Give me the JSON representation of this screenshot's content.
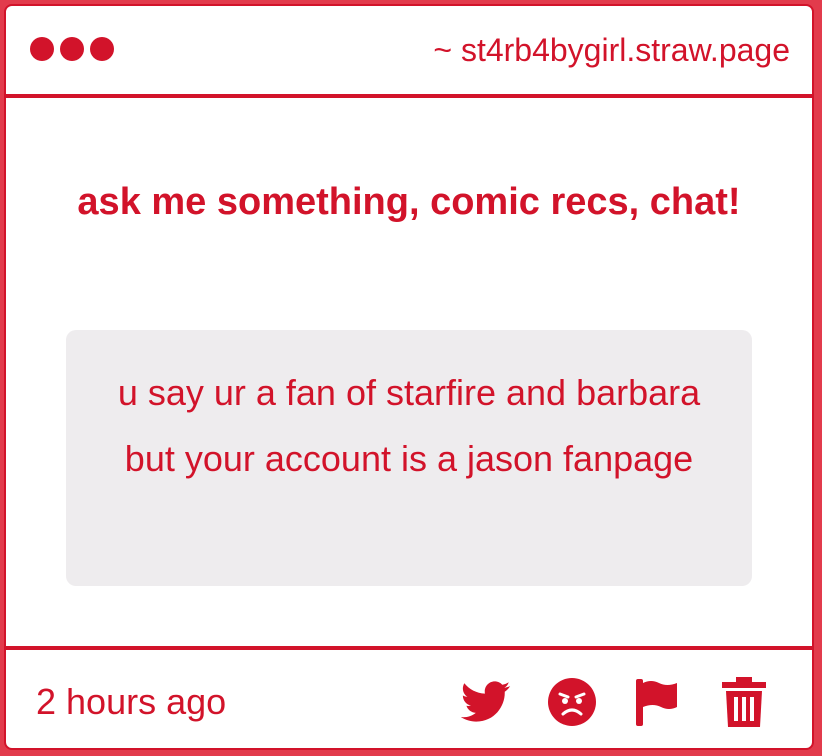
{
  "header": {
    "site": "~ st4rb4bygirl.straw.page"
  },
  "prompt": {
    "title": "ask me something, comic recs, chat!"
  },
  "question": {
    "text": "u say ur a fan of starfire and barbara but your account is a jason fanpage"
  },
  "footer": {
    "time": "2 hours ago",
    "actions": [
      "twitter-icon",
      "angry-face-icon",
      "flag-icon",
      "trash-icon"
    ]
  },
  "colors": {
    "accent": "#d2132a",
    "background": "#e23b4c",
    "bubble": "#eeecee"
  }
}
